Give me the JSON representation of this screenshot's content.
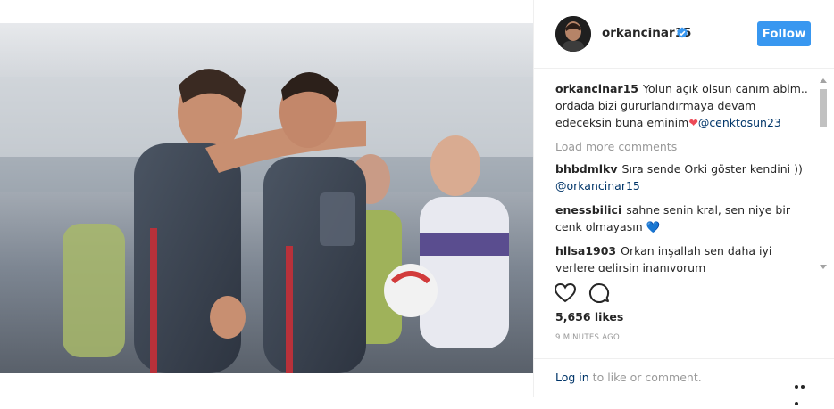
{
  "post": {
    "username": "orkancinar15",
    "follow_label": "Follow",
    "photo_icon": "football-players-photo",
    "likes": "5,656 likes",
    "time": "9 MINUTES AGO",
    "load_more": "Load more comments",
    "caption": {
      "user": "orkancinar15",
      "text": "Yolun açık olsun canım abim.. ordada bizi gururlandırmaya devam edeceksin buna eminim",
      "emoji": "❤",
      "mention": "@cenktosun23"
    },
    "comments": [
      {
        "user": "bhbdmlkv",
        "text": "Sıra sende Orki göster kendini ))",
        "mention": "@orkancinar15",
        "emoji": ""
      },
      {
        "user": "enessbilici",
        "text": "sahne senin kral, sen niye bir cenk olmayasın",
        "mention": "",
        "emoji": "💙"
      },
      {
        "user": "hllsa1903",
        "text": "Orkan inşallah sen daha iyi yerlere gelirsin inanıyorum",
        "mention": "",
        "emoji": ""
      }
    ],
    "footer": {
      "login_label": "Log in",
      "login_suffix": " to like or comment."
    }
  },
  "colors": {
    "accent": "#3897f0",
    "mention": "#003569",
    "muted": "#999999",
    "heart": "#ed4956",
    "blue_heart": "#3897f0"
  },
  "icons": [
    "verified-badge-icon",
    "heart-icon",
    "comment-icon",
    "more-options-icon"
  ]
}
